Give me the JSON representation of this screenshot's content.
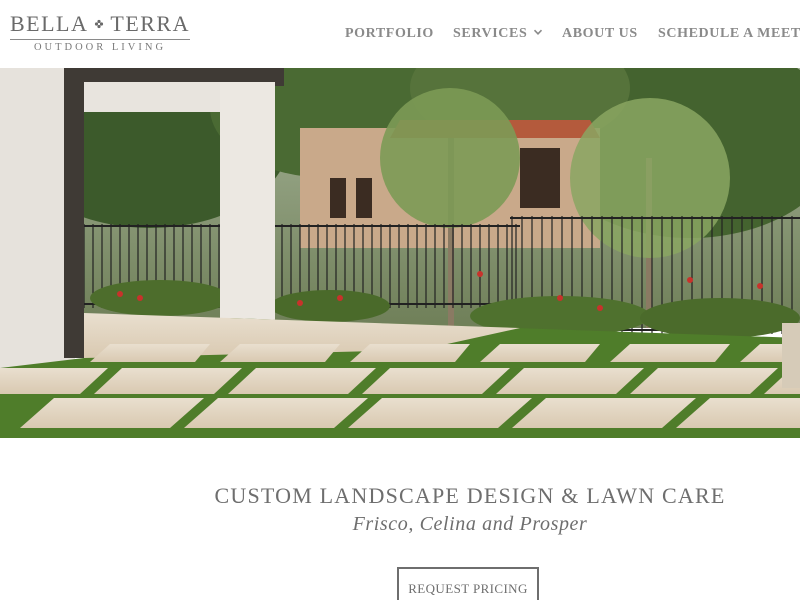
{
  "brand": {
    "name_left": "BELLA",
    "name_right": "TERRA",
    "tagline": "OUTDOOR LIVING",
    "mark_icon": "flower-ornament-icon"
  },
  "nav": {
    "portfolio": "PORTFOLIO",
    "services": "SERVICES",
    "about": "ABOUT US",
    "schedule": "SCHEDULE A MEETI",
    "services_icon": "chevron-down-icon"
  },
  "hero": {
    "image": "backyard-landscape-photo"
  },
  "main": {
    "headline": "CUSTOM LANDSCAPE DESIGN & LAWN CARE",
    "subheadline": "Frisco, Celina and Prosper",
    "cta_label": "REQUEST PRICING"
  },
  "colors": {
    "text": "#6e6e6e",
    "nav": "#8a8a8a",
    "grass": "#4f7d2a",
    "stone": "#e8dccb"
  }
}
